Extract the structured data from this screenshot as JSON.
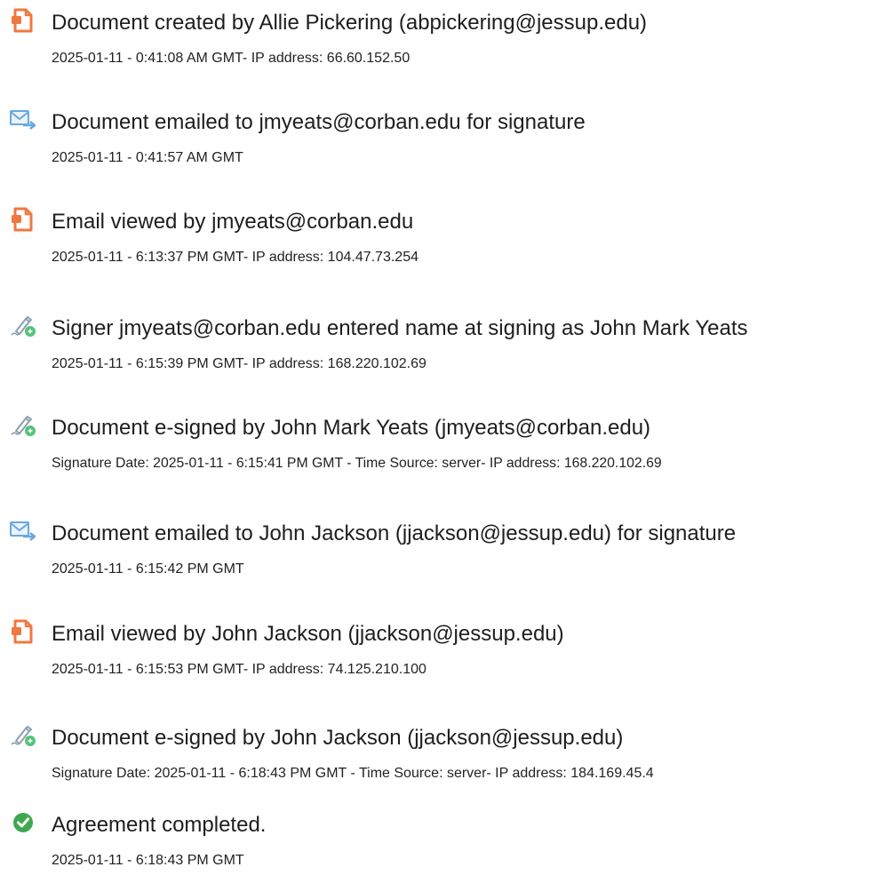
{
  "colors": {
    "doc_icon": "#f07840",
    "email_icon": "#6aa8e0",
    "sign_icon": "#55c27a",
    "complete_icon": "#3fa84f"
  },
  "events": [
    {
      "icon": "document-icon",
      "title": "Document created by Allie Pickering (abpickering@jessup.edu)",
      "detail": "2025-01-11 - 0:41:08 AM GMT- IP address: 66.60.152.50"
    },
    {
      "icon": "email-send-icon",
      "title": "Document emailed to jmyeats@corban.edu for signature",
      "detail": "2025-01-11 - 0:41:57 AM GMT"
    },
    {
      "icon": "document-icon",
      "title": "Email viewed by jmyeats@corban.edu",
      "detail": "2025-01-11 - 6:13:37 PM GMT- IP address: 104.47.73.254"
    },
    {
      "icon": "signature-pen-icon",
      "title": "Signer jmyeats@corban.edu entered name at signing as John Mark Yeats",
      "detail": "2025-01-11 - 6:15:39 PM GMT- IP address: 168.220.102.69"
    },
    {
      "icon": "signature-pen-icon",
      "title": "Document e-signed by John Mark Yeats (jmyeats@corban.edu)",
      "detail": "Signature Date: 2025-01-11 - 6:15:41 PM GMT - Time Source: server- IP address: 168.220.102.69"
    },
    {
      "icon": "email-send-icon",
      "title": "Document emailed to John Jackson (jjackson@jessup.edu) for signature",
      "detail": "2025-01-11 - 6:15:42 PM GMT"
    },
    {
      "icon": "document-icon",
      "title": "Email viewed by John Jackson (jjackson@jessup.edu)",
      "detail": "2025-01-11 - 6:15:53 PM GMT- IP address: 74.125.210.100"
    },
    {
      "icon": "signature-pen-icon",
      "title": "Document e-signed by John Jackson (jjackson@jessup.edu)",
      "detail": "Signature Date: 2025-01-11 - 6:18:43 PM GMT - Time Source: server- IP address: 184.169.45.4"
    },
    {
      "icon": "checkmark-circle-icon",
      "title": "Agreement completed.",
      "detail": "2025-01-11 - 6:18:43 PM GMT"
    }
  ]
}
